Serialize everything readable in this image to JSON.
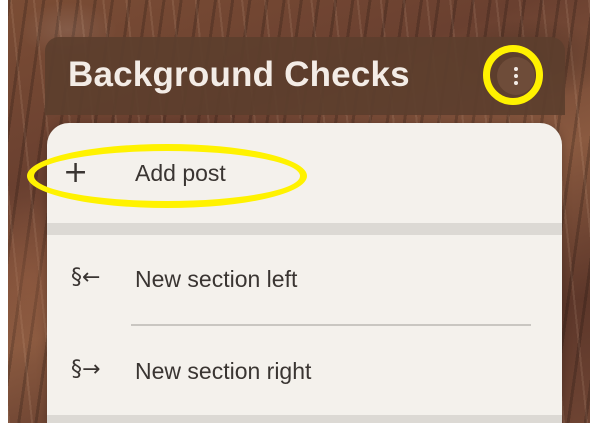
{
  "board": {
    "title": "Background Checks"
  },
  "menu": {
    "items": [
      {
        "icon": "plus-icon",
        "glyph": "+",
        "label": "Add post"
      },
      {
        "icon": "section-left-icon",
        "glyph": "§←",
        "label": "New section left"
      },
      {
        "icon": "section-right-icon",
        "glyph": "§→",
        "label": "New section right"
      }
    ]
  },
  "annotations": {
    "highlight_color": "#fff200",
    "highlighted": [
      "board-options-button",
      "add-post-item"
    ]
  },
  "colors": {
    "header_bg": "#5c3e2d",
    "header_text": "#f3ece6",
    "menu_bg": "#f4f1ec",
    "menu_divider": "#dcd9d4",
    "menu_text": "#3a3532"
  }
}
